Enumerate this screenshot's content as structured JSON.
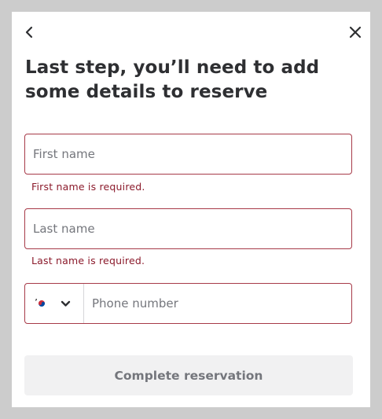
{
  "header": {
    "back_icon": "chevron-left-icon",
    "close_icon": "close-icon",
    "title": "Last step, you’ll need to add some details to reserve"
  },
  "form": {
    "first_name": {
      "value": "",
      "placeholder": "First name",
      "error": "First name is required."
    },
    "last_name": {
      "value": "",
      "placeholder": "Last name",
      "error": "Last name is required."
    },
    "phone": {
      "value": "",
      "placeholder": "Phone number",
      "country_flag": "south-korea-flag-icon",
      "dropdown_icon": "chevron-down-icon"
    }
  },
  "actions": {
    "submit_label": "Complete reservation"
  },
  "colors": {
    "error_border": "#a73a48",
    "error_text": "#8b1a2b",
    "title": "#2e2f32",
    "disabled_button_bg": "#f1f1f2"
  }
}
